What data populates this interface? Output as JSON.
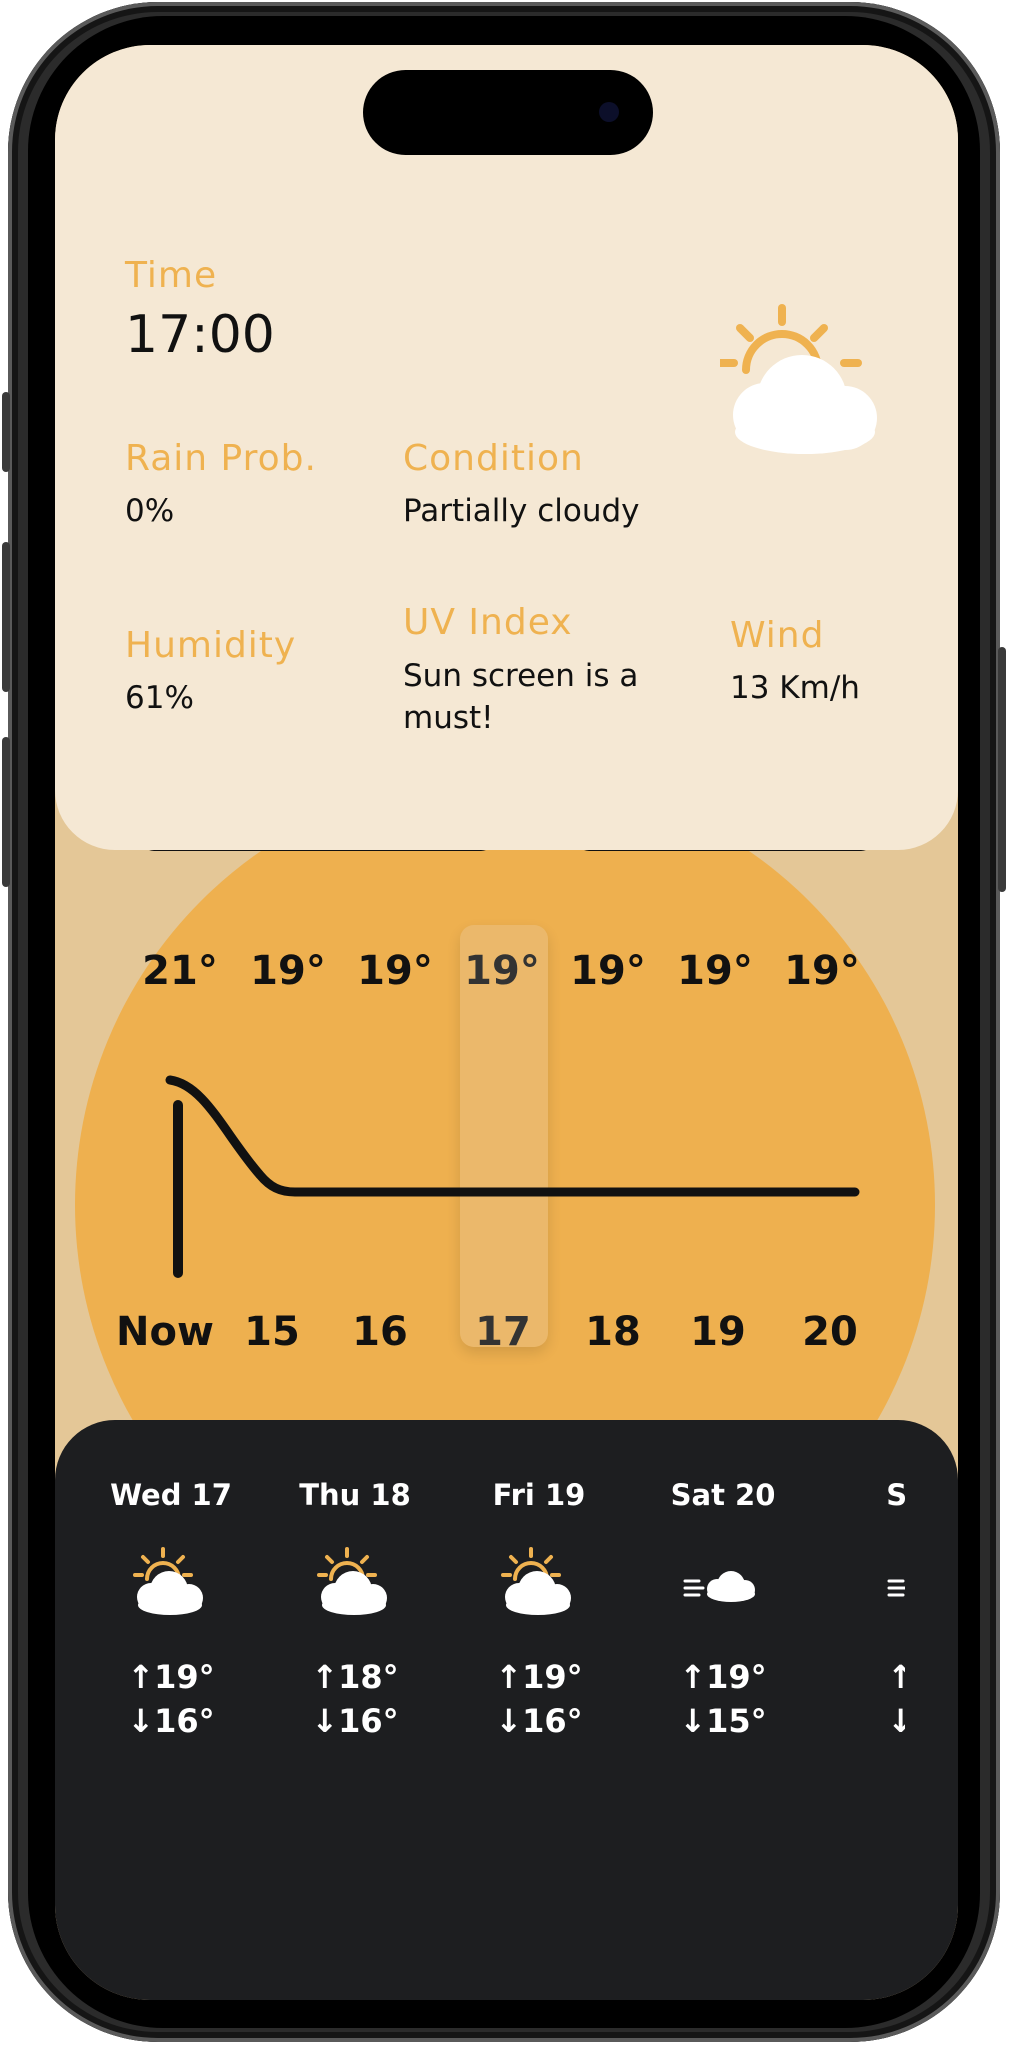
{
  "current": {
    "time_label": "Time",
    "time": "17:00",
    "rain_label": "Rain Prob.",
    "rain": "0%",
    "condition_label": "Condition",
    "condition": "Partially cloudy",
    "humidity_label": "Humidity",
    "humidity": "61%",
    "uv_label": "UV Index",
    "uv_line1": "Sun screen is a",
    "uv_line2": "must!",
    "wind_label": "Wind",
    "wind": "13 Km/h",
    "icon": "partly-cloudy-icon"
  },
  "hourly": {
    "temps": [
      "21°",
      "19°",
      "19°",
      "19°",
      "19°",
      "19°",
      "19°"
    ],
    "hours": [
      "Now",
      "15",
      "16",
      "17",
      "18",
      "19",
      "20"
    ],
    "selected_index": 3
  },
  "daily": [
    {
      "day": "Wed 17",
      "hi": "↑19°",
      "lo": "↓16°",
      "icon": "partly-cloudy-icon"
    },
    {
      "day": "Thu 18",
      "hi": "↑18°",
      "lo": "↓16°",
      "icon": "partly-cloudy-icon"
    },
    {
      "day": "Fri 19",
      "hi": "↑19°",
      "lo": "↓16°",
      "icon": "partly-cloudy-icon"
    },
    {
      "day": "Sat 20",
      "hi": "↑19°",
      "lo": "↓15°",
      "icon": "windy-cloud-icon"
    },
    {
      "day": "Su",
      "hi": "↑:",
      "lo": "↓:",
      "icon": "windy-icon"
    }
  ],
  "colors": {
    "accent": "#efb250",
    "card_bg": "#f5e8d4",
    "sun_disc": "#eeb04f",
    "dark_card": "#1d1e20"
  }
}
